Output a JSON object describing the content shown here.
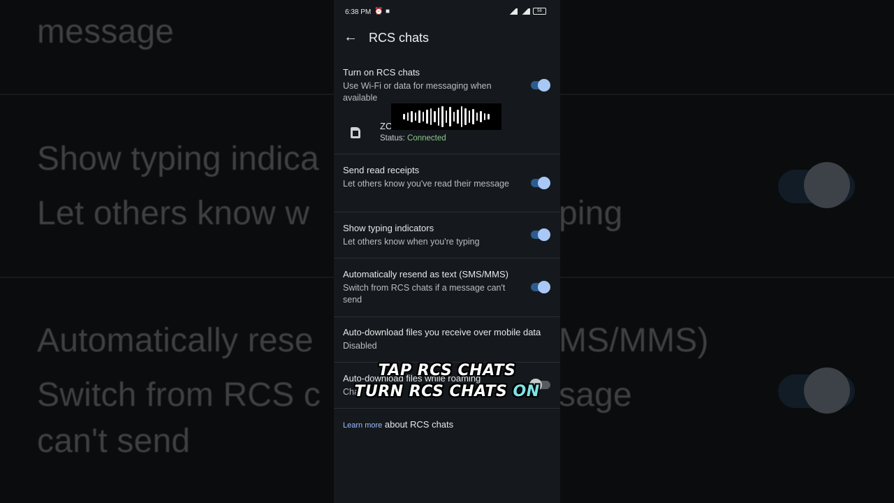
{
  "background": {
    "lines": [
      "message",
      "Show typing indica",
      "Let others know w",
      "ping",
      "Automatically rese",
      "MS/MMS)",
      "Switch from RCS c",
      "sage",
      "can't send"
    ]
  },
  "statusbar": {
    "time": "6:38 PM",
    "battery": "56"
  },
  "appbar": {
    "title": "RCS chats"
  },
  "settings": [
    {
      "title": "Turn on RCS chats",
      "subtitle": "Use Wi-Fi or data for messaging when available",
      "toggle": true
    },
    {
      "title": "Send read receipts",
      "subtitle": "Let others know you've read their message",
      "toggle": true
    },
    {
      "title": "Show typing indicators",
      "subtitle": "Let others know when you're typing",
      "toggle": true
    },
    {
      "title": "Automatically resend as text (SMS/MMS)",
      "subtitle": "Switch from RCS chats if a message can't send",
      "toggle": true
    },
    {
      "title": "Auto-download files you receive over mobile data",
      "subtitle": "Disabled"
    },
    {
      "title": "Auto-download files while roaming",
      "subtitle": "Cha",
      "toggle": false
    }
  ],
  "sim": {
    "name": "ZC",
    "status_label": "Status:",
    "status_value": "Connected"
  },
  "learn_more": {
    "link": "Learn more",
    "text": " about RCS chats"
  },
  "overlay": {
    "line1": "TAP RCS CHATS",
    "line2_prefix": "TURN RCS CHATS ",
    "line2_highlight": "ON"
  },
  "colors": {
    "accent": "#a9c8f5",
    "toggle_track": "#2c5b8f",
    "status_ok": "#8bc98a",
    "caption_highlight": "#7fe3e6"
  }
}
